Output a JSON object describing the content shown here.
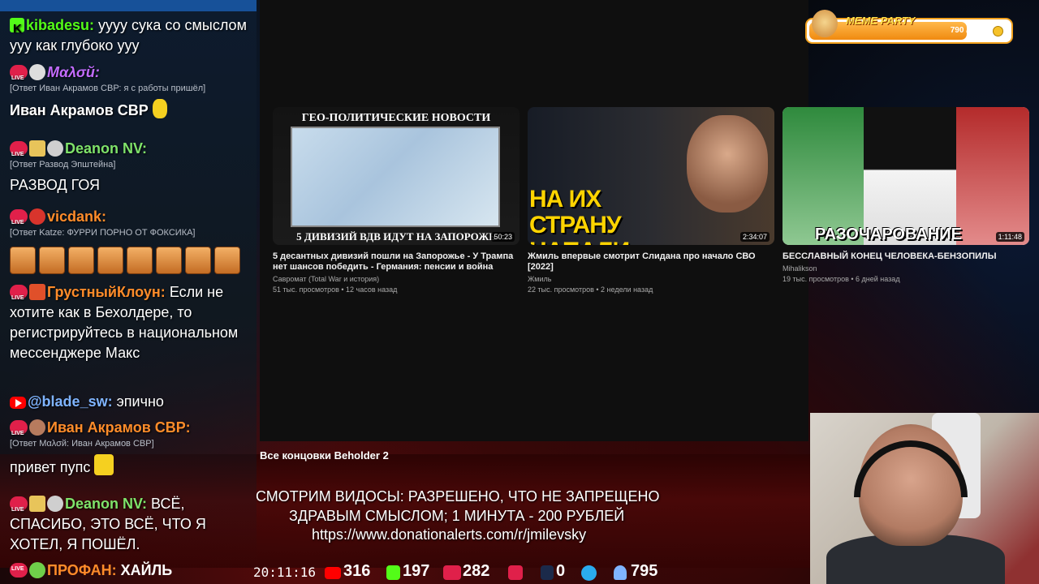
{
  "chat": {
    "messages": [
      {
        "user": "kibadesu:",
        "text": "уууу сука со смыслом ууу как глубоко ууу"
      },
      {
        "user": "Mαλσй:",
        "reply": "[Ответ Иван Акрамов СВР: я с работы пришёл]",
        "text": "Иван Акрамов СВР"
      },
      {
        "user": "Deanon NV:",
        "reply": "[Ответ Развод Эпштейна]",
        "text": "РАЗВОД ГОЯ"
      },
      {
        "user": "vicdank:",
        "reply": "[Ответ Katze: ФУРРИ ПОРНО ОТ ФОКСИКА]"
      },
      {
        "user": "ГрустныйКлоун:",
        "text": "Если не хотите как в Бехолдере, то регистрируйтесь в национальном мессенджере Макс"
      },
      {
        "user": "@blade_sw:",
        "text": "эпично"
      },
      {
        "user": "Иван Акрамов СВР:",
        "reply": "[Ответ Mαλσй: Иван Акрамов СВР]",
        "text": "привет пупс"
      },
      {
        "user": "Deanon NV:",
        "text": "ВСЁ, СПАСИБО, ЭТО ВСЁ, ЧТО Я ХОТЕЛ, Я ПОШЁЛ."
      },
      {
        "user": "ПРОФАН:",
        "text": "ХАЙЛЬ"
      }
    ]
  },
  "videos": [
    {
      "thumb_head": "ГЕО-ПОЛИТИЧЕСКИЕ НОВОСТИ",
      "thumb_foot": "5 ДИВИЗИЙ ВДВ ИДУТ НА ЗАПОРОЖЬ",
      "duration": "50:23",
      "title": "5 десантных дивизий пошли на Запорожье - У Трампа нет шансов победить - Германия: пенсии и война",
      "channel": "Савромат (Total War и история)",
      "meta": "51 тыс. просмотров • 12 часов назад"
    },
    {
      "thumb_text": "НА ИХ СТРАНУ НАПАЛИ",
      "duration": "2:34:07",
      "title": "Жмиль впервые смотрит Слидана про начало СВО [2022]",
      "channel": "Жмиль",
      "meta": "22 тыс. просмотров • 2 недели назад"
    },
    {
      "thumb_text": "РАЗОЧАРОВАНИЕ",
      "duration": "1:11:48",
      "title": "БЕССЛАВНЫЙ КОНЕЦ ЧЕЛОВЕКА-БЕНЗОПИЛЫ",
      "channel": "Mihalikson",
      "meta": "19 тыс. просмотров • 6 дней назад"
    }
  ],
  "playlist_title": "Все концовки Beholder 2",
  "meme_party": {
    "label": "MEME PARTY",
    "score": "790 / 1000",
    "progress": 0.79
  },
  "rules": {
    "line1": "СМОТРИМ ВИДОСЫ: РАЗРЕШЕНО, ЧТО НЕ ЗАПРЕЩЕНО",
    "line2": "ЗДРАВЫМ СМЫСЛОМ; 1 МИНУТА - 200 РУБЛЕЙ",
    "line3": "https://www.donationalerts.com/r/jmilevsky"
  },
  "stats": {
    "clock": "20:11:16",
    "youtube": "316",
    "kick": "197",
    "live": "282",
    "rutube": "0",
    "telegram": "795"
  },
  "colors": {
    "youtube": "#ff0000",
    "kick": "#53fc18",
    "live": "#e0204a",
    "telegram": "#2aabee",
    "name_kick": "#53fc18",
    "name_purple": "#c36cff",
    "name_green": "#7fe36a",
    "name_orange": "#ff8c2a",
    "name_blue": "#7fb4ff"
  }
}
